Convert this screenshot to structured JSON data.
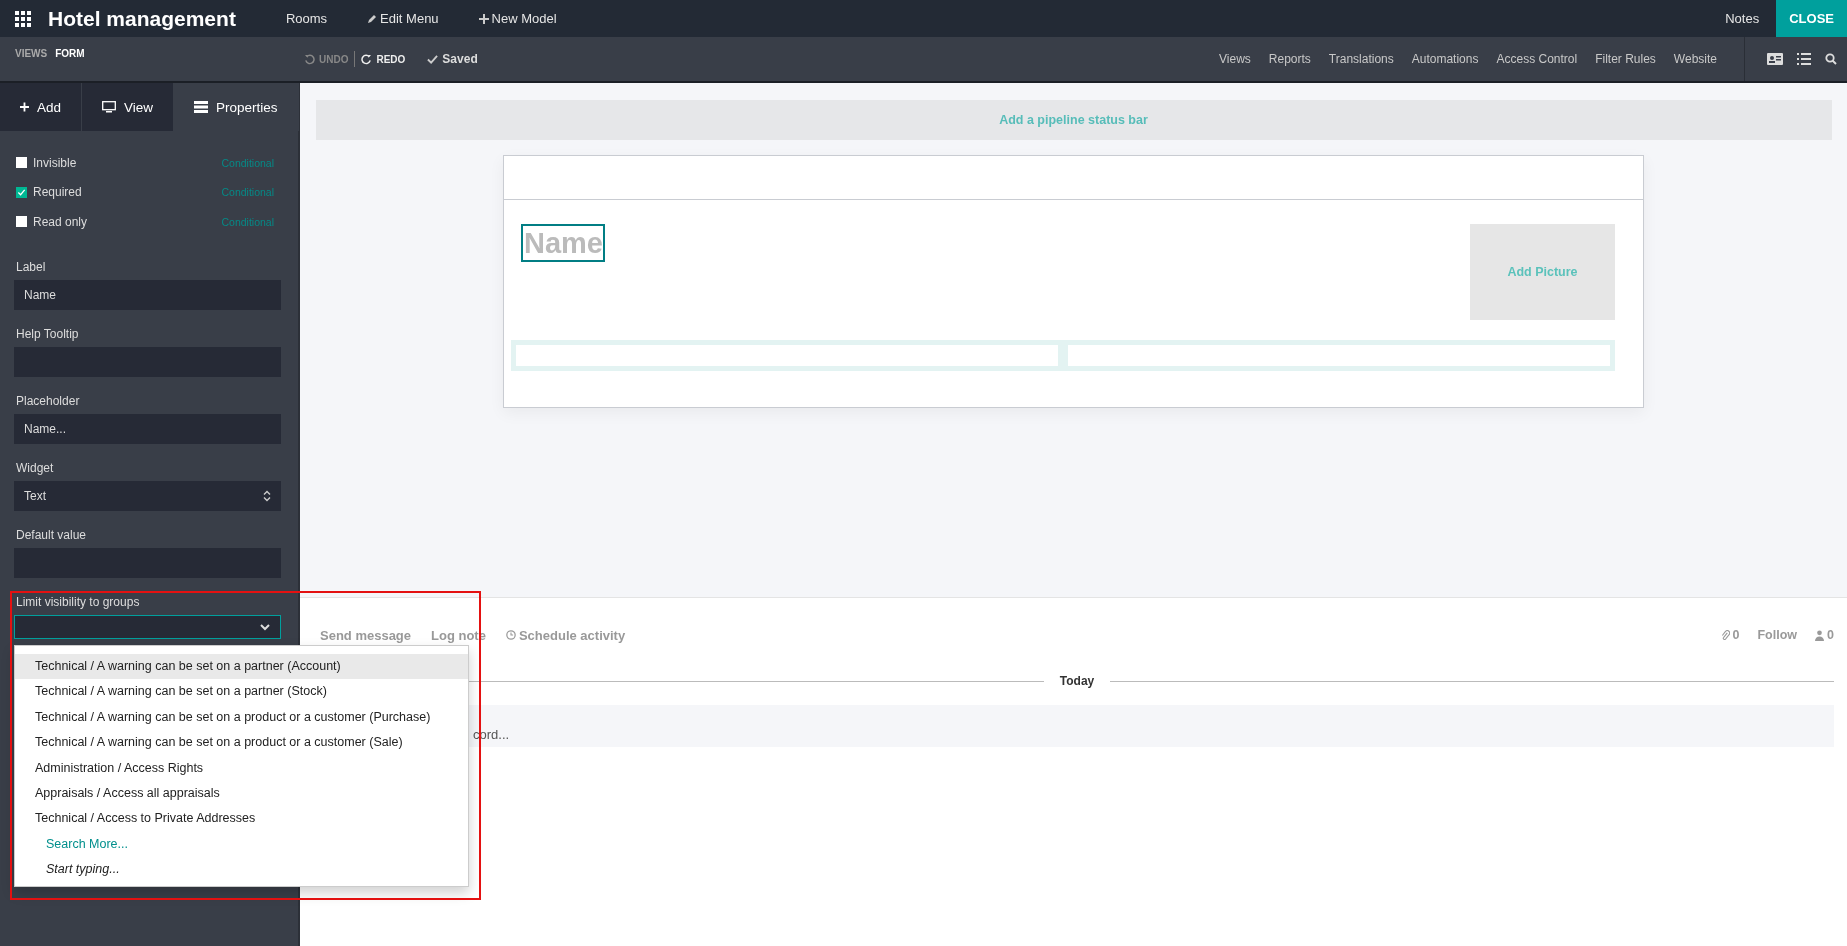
{
  "app": {
    "title": "Hotel management",
    "menu": [
      "Rooms",
      "Edit Menu",
      "New Model"
    ],
    "notes": "Notes",
    "close": "CLOSE"
  },
  "toolbar": {
    "breadcrumb": [
      "VIEWS",
      "FORM"
    ],
    "undo": {
      "label": "UNDO",
      "disabled": true
    },
    "redo": {
      "label": "REDO",
      "disabled": false
    },
    "saved": "Saved",
    "links": [
      "Views",
      "Reports",
      "Translations",
      "Automations",
      "Access Control",
      "Filter Rules",
      "Website"
    ]
  },
  "sidebar": {
    "tabs": [
      {
        "label": "Add",
        "selected": false
      },
      {
        "label": "View",
        "selected": false
      },
      {
        "label": "Properties",
        "selected": true
      }
    ],
    "options": [
      {
        "label": "Invisible",
        "checked": false,
        "link": "Conditional"
      },
      {
        "label": "Required",
        "checked": true,
        "link": "Conditional"
      },
      {
        "label": "Read only",
        "checked": false,
        "link": "Conditional"
      }
    ],
    "fields": [
      {
        "label": "Label",
        "kind": "text",
        "value": "Name"
      },
      {
        "label": "Help Tooltip",
        "kind": "text"
      },
      {
        "label": "Placeholder",
        "kind": "text",
        "value": "Name..."
      },
      {
        "label": "Widget",
        "kind": "select",
        "value": "Text"
      },
      {
        "label": "Default value",
        "kind": "text"
      }
    ],
    "groups": {
      "label": "Limit visibility to groups",
      "expanded": true,
      "items": [
        {
          "label": "Technical / A warning can be set on a partner (Account)",
          "selected": true
        },
        {
          "label": "Technical / A warning can be set on a partner (Stock)",
          "selected": false
        },
        {
          "label": "Technical / A warning can be set on a product or a customer (Purchase)",
          "selected": false
        },
        {
          "label": "Technical / A warning can be set on a product or a customer (Sale)",
          "selected": false
        },
        {
          "label": "Administration / Access Rights",
          "selected": false
        },
        {
          "label": "Appraisals / Access all appraisals",
          "selected": false
        },
        {
          "label": "Technical / Access to Private Addresses",
          "selected": false
        }
      ],
      "search_more": "Search More...",
      "start_typing": "Start typing..."
    }
  },
  "form": {
    "status_bar": "Add a pipeline status bar",
    "name_placeholder": "Name",
    "picture": "Add Picture"
  },
  "chatter": {
    "actions": [
      "Send message",
      "Log note",
      "Schedule activity"
    ],
    "attachments": "0",
    "follow": "Follow",
    "followers": "0",
    "divider": "Today",
    "note": "cord..."
  }
}
